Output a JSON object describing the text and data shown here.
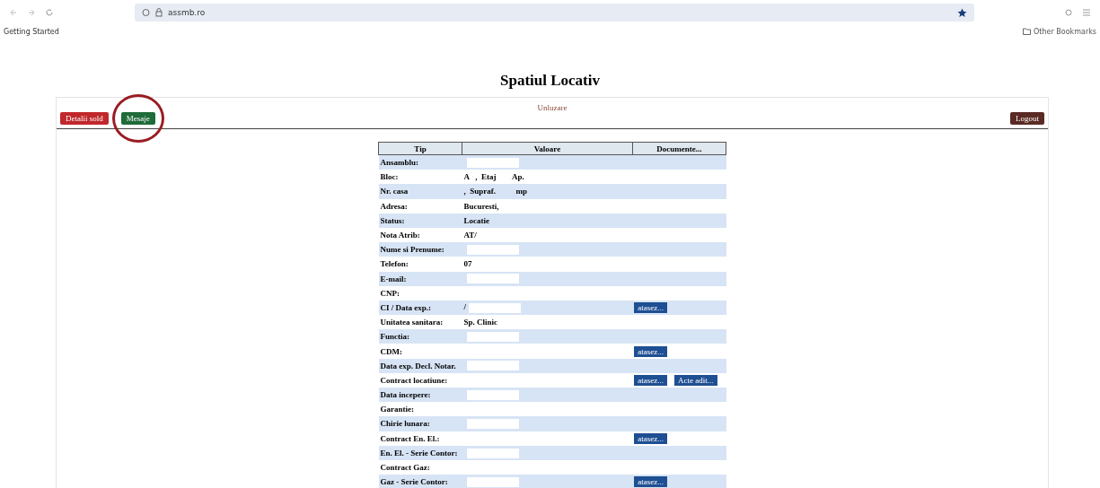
{
  "browser": {
    "url": "assmb.ro",
    "bookmarks": [
      "Getting Started"
    ],
    "other_bookmarks": "Other Bookmarks"
  },
  "page": {
    "title": "Spatiul Locativ",
    "user_label": "Unluzare",
    "left_buttons": [
      {
        "label": "Detalii sold",
        "color": "#c0282c"
      },
      {
        "label": "Mesaje",
        "color": "#1f6b3a",
        "circled": true
      }
    ],
    "logout": "Logout"
  },
  "table": {
    "columns": [
      "Tip",
      "Valoare",
      "Documente..."
    ],
    "rows": [
      {
        "tip": "Ansamblu:",
        "value": "",
        "field": true,
        "buttons": []
      },
      {
        "tip": "Bloc:",
        "value": "A   ,  Etaj        Ap.",
        "field": false,
        "buttons": []
      },
      {
        "tip": "Nr. casa",
        "value": ",  Supraf.          mp",
        "field": false,
        "buttons": []
      },
      {
        "tip": "Adresa:",
        "value": "Bucuresti,",
        "field": false,
        "buttons": []
      },
      {
        "tip": "Status:",
        "value": "Locatie",
        "field": false,
        "buttons": []
      },
      {
        "tip": "Nota Atrib:",
        "value": "AT/",
        "field": false,
        "buttons": []
      },
      {
        "tip": "Nume si Prenume:",
        "value": "",
        "field": true,
        "buttons": []
      },
      {
        "tip": "Telefon:",
        "value": "07",
        "field": false,
        "buttons": []
      },
      {
        "tip": "E-mail:",
        "value": "",
        "field": true,
        "buttons": []
      },
      {
        "tip": "CNP:",
        "value": "",
        "field": false,
        "buttons": []
      },
      {
        "tip": "CI / Data exp.:",
        "value": "/",
        "field": true,
        "buttons": [
          "atasez..."
        ]
      },
      {
        "tip": "Unitatea sanitara:",
        "value": "Sp. Clinic",
        "field": false,
        "buttons": []
      },
      {
        "tip": "Functia:",
        "value": "",
        "field": true,
        "buttons": []
      },
      {
        "tip": "CDM:",
        "value": "",
        "field": false,
        "buttons": [
          "atasez..."
        ]
      },
      {
        "tip": "Data exp. Decl. Notar.",
        "value": "",
        "field": true,
        "buttons": []
      },
      {
        "tip": "Contract locatiune:",
        "value": "",
        "field": false,
        "buttons": [
          "atasez...",
          "Acte adit..."
        ]
      },
      {
        "tip": "Data incepere:",
        "value": "",
        "field": true,
        "buttons": []
      },
      {
        "tip": "Garantie:",
        "value": "",
        "field": false,
        "buttons": []
      },
      {
        "tip": "Chirie lunara:",
        "value": "",
        "field": true,
        "buttons": []
      },
      {
        "tip": "Contract En. El.:",
        "value": "",
        "field": false,
        "buttons": [
          "atasez..."
        ]
      },
      {
        "tip": "En. El. - Serie Contor:",
        "value": "",
        "field": true,
        "buttons": []
      },
      {
        "tip": "Contract Gaz:",
        "value": "",
        "field": false,
        "buttons": []
      },
      {
        "tip": "Gaz - Serie Contor:",
        "value": "",
        "field": true,
        "buttons": [
          "atasez..."
        ]
      }
    ]
  }
}
